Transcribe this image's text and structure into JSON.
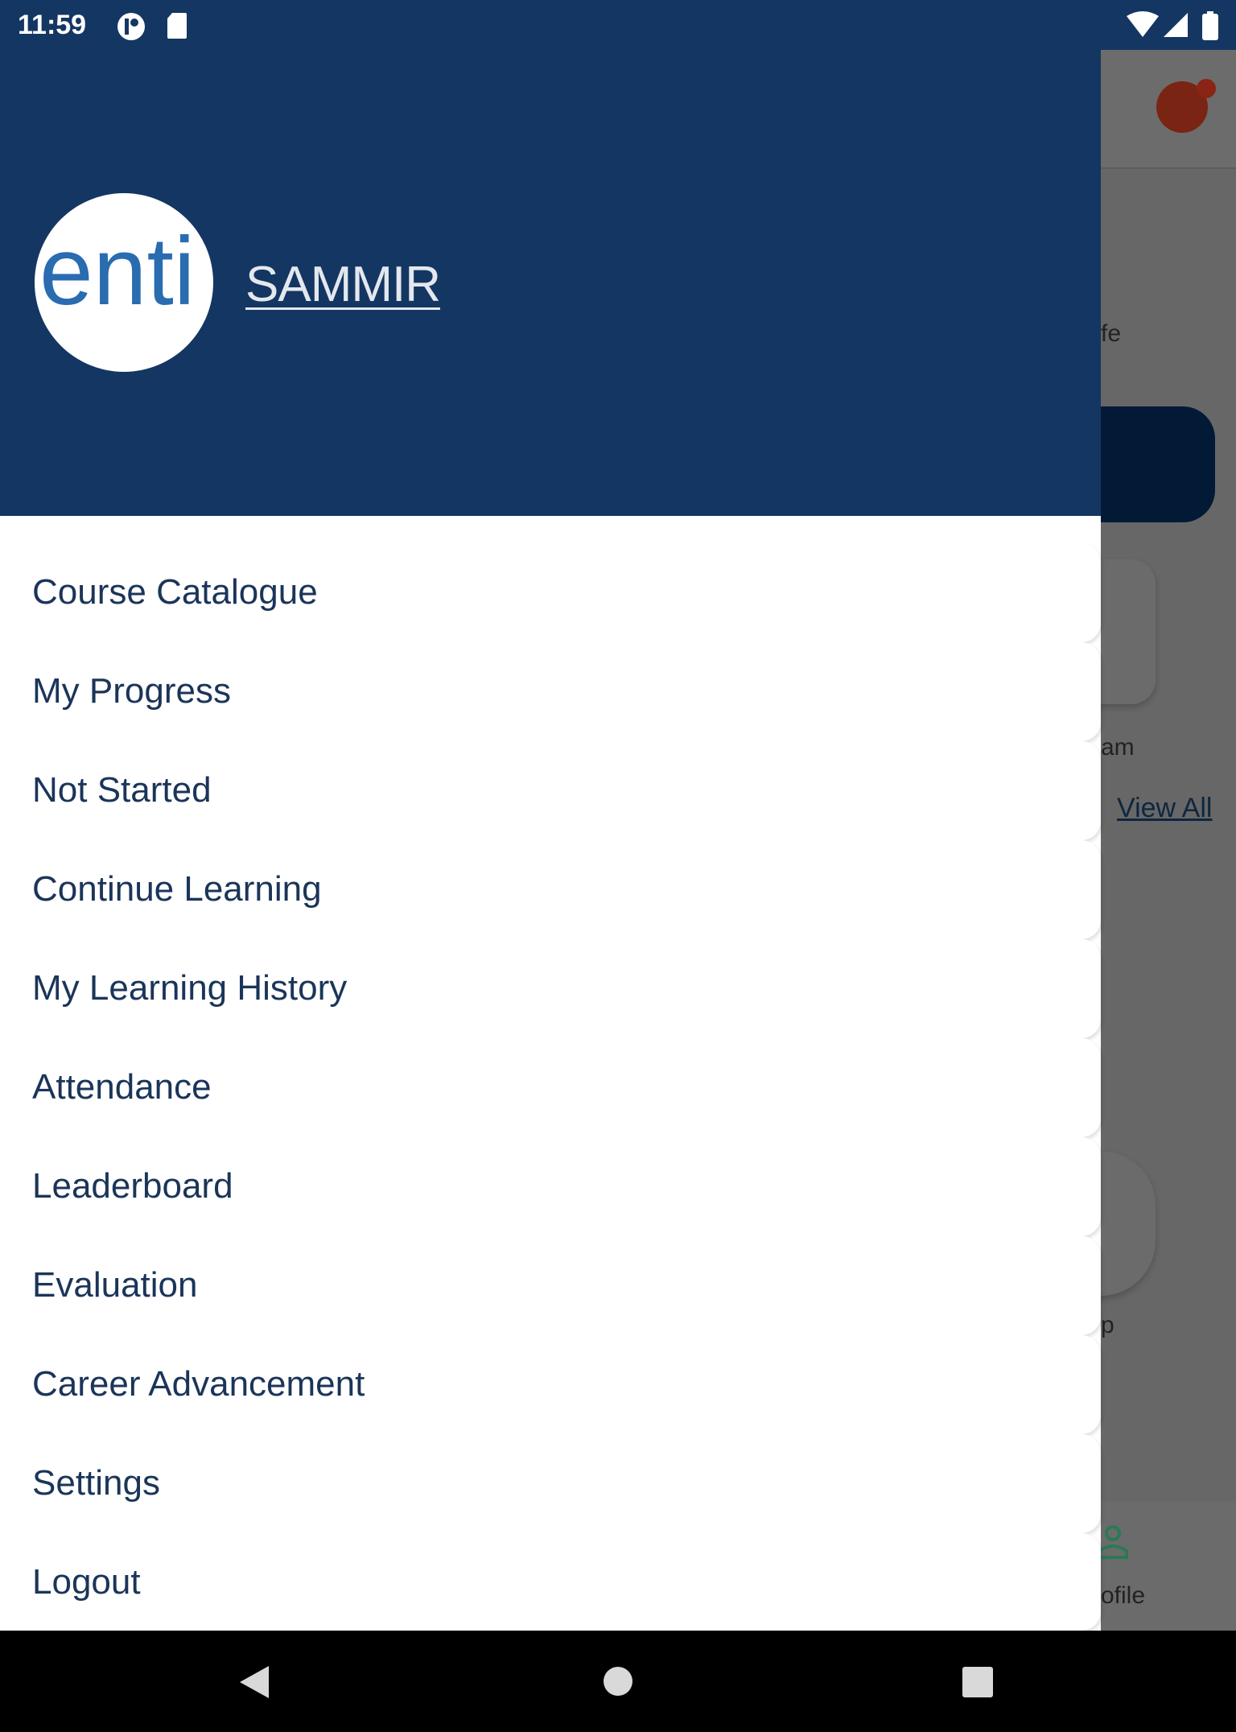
{
  "status_bar": {
    "time": "11:59",
    "icons": [
      "notification-icon",
      "sd-card-icon",
      "wifi-icon",
      "signal-icon",
      "battery-icon"
    ]
  },
  "drawer": {
    "user_name": "SAMMIR",
    "logo_text": "enti",
    "items": [
      {
        "label": "Course Catalogue"
      },
      {
        "label": "My Progress"
      },
      {
        "label": "Not Started"
      },
      {
        "label": "Continue Learning"
      },
      {
        "label": "My Learning History"
      },
      {
        "label": "Attendance"
      },
      {
        "label": "Leaderboard"
      },
      {
        "label": "Evaluation"
      },
      {
        "label": "Career Advancement"
      },
      {
        "label": "Settings"
      },
      {
        "label": "Logout"
      }
    ]
  },
  "background": {
    "text1": "fe",
    "text2": "am",
    "view_all": "View All",
    "text3": "p",
    "nav_profile": "ofile"
  },
  "colors": {
    "header": "#143662",
    "item_text": "#1b3559",
    "overlay": "#676767"
  }
}
